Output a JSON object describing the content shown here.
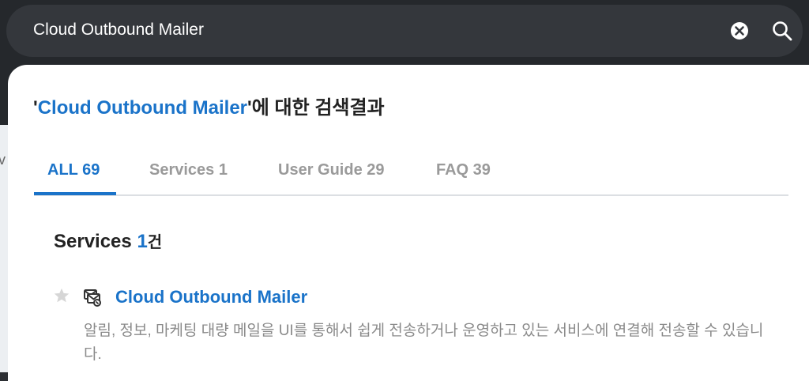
{
  "search": {
    "query": "Cloud Outbound Mailer"
  },
  "background": {
    "fragment": "v"
  },
  "results": {
    "heading_open_quote": "'",
    "heading_keyword": "Cloud Outbound Mailer",
    "heading_suffix": "'에 대한 검색결과"
  },
  "tabs": [
    {
      "label": "ALL 69",
      "active": true
    },
    {
      "label": "Services 1",
      "active": false
    },
    {
      "label": "User Guide 29",
      "active": false
    },
    {
      "label": "FAQ 39",
      "active": false
    }
  ],
  "section": {
    "title": "Services",
    "count": "1",
    "unit": "건"
  },
  "items": [
    {
      "title": "Cloud Outbound Mailer",
      "description": "알림, 정보, 마케팅 대량 메일을 UI를 통해서 쉽게 전송하거나 운영하고 있는 서비스에 연결해 전송할 수 있습니다.",
      "icon": "mail-service-icon",
      "favorite": false
    }
  ],
  "colors": {
    "accent": "#1a73c9",
    "search_bar": "#34373c",
    "muted_text": "#8a8a8a"
  }
}
